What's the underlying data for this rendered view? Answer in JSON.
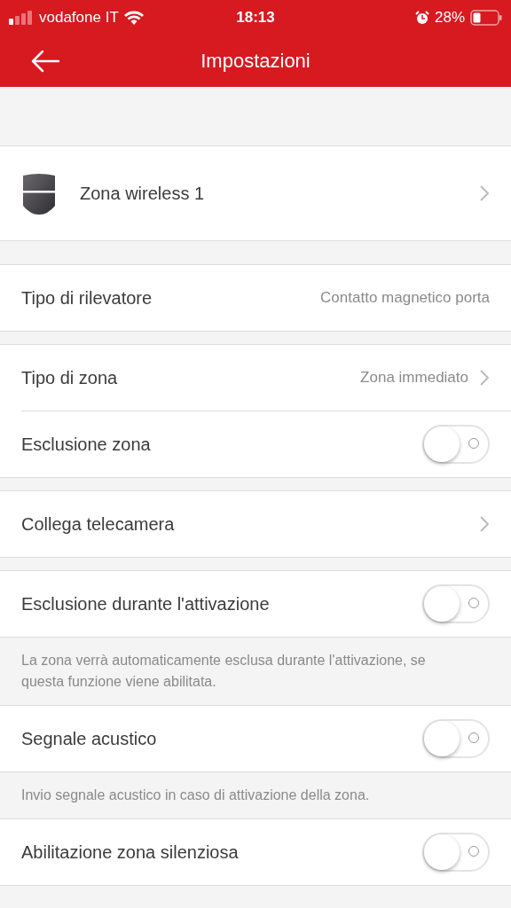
{
  "status_bar": {
    "carrier": "vodafone IT",
    "time": "18:13",
    "battery": "28%"
  },
  "nav": {
    "title": "Impostazioni"
  },
  "sections": [
    {
      "rows": [
        {
          "kind": "device",
          "label": "Zona wireless 1"
        }
      ]
    },
    {
      "rows": [
        {
          "kind": "value",
          "label": "Tipo di rilevatore",
          "value": "Contatto magnetico porta"
        }
      ]
    },
    {
      "rows": [
        {
          "kind": "link",
          "label": "Tipo di zona",
          "value": "Zona immediato"
        },
        {
          "kind": "toggle",
          "label": "Esclusione zona",
          "on": false
        }
      ]
    },
    {
      "rows": [
        {
          "kind": "link",
          "label": "Collega telecamera"
        }
      ]
    },
    {
      "rows": [
        {
          "kind": "toggle",
          "label": "Esclusione durante l'attivazione",
          "on": false
        }
      ],
      "note": "La zona verrà automaticamente esclusa durante l'attivazione, se questa funzione viene abilitata."
    },
    {
      "rows": [
        {
          "kind": "toggle",
          "label": "Segnale acustico",
          "on": false
        }
      ],
      "note": "Invio segnale acustico in caso di attivazione della zona."
    },
    {
      "rows": [
        {
          "kind": "toggle",
          "label": "Abilitazione zona silenziosa",
          "on": false
        }
      ]
    }
  ]
}
